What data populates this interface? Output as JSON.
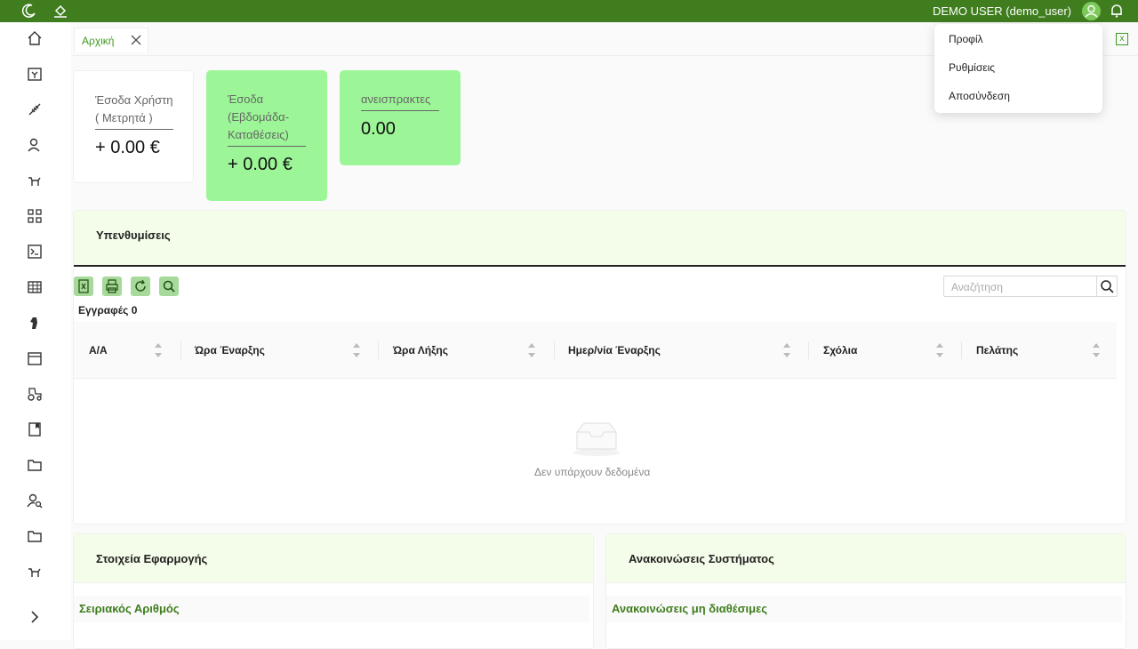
{
  "header": {
    "user_label": "DEMO USER (demo_user)",
    "icons": [
      "moon-icon",
      "paint-bucket-icon",
      "user-avatar-icon",
      "bell-icon"
    ]
  },
  "user_menu": {
    "items": [
      "Προφίλ",
      "Ρυθμίσεις",
      "Αποσύνδεση"
    ]
  },
  "sidebar": {
    "icons": [
      "home-icon",
      "calendar-yen-icon",
      "wheat-icon",
      "user-icon",
      "cow-icon",
      "qrcode-icon",
      "terminal-icon",
      "table-icon",
      "horse-head-icon",
      "calendar-icon",
      "tractor-icon",
      "book-icon",
      "folder-icon",
      "user-search-icon",
      "folder-icon",
      "cow-icon",
      "chevron-right-icon"
    ]
  },
  "tabs": {
    "active_label": "Αρχική"
  },
  "cards": [
    {
      "title": "Έσοδα Χρήστη ( Μετρητά )",
      "value": "+ 0.00 €"
    },
    {
      "title": "Έσοδα (Εβδομάδα-Καταθέσεις)",
      "value": "+ 0.00 €"
    },
    {
      "title": "ανεισπρακτες",
      "value": "0.00"
    }
  ],
  "reminders": {
    "title": "Υπενθυμίσεις",
    "records_label": "Εγγραφές 0",
    "search_placeholder": "Αναζήτηση",
    "columns": [
      "Α/Α",
      "Ώρα Έναρξης",
      "Ώρα Λήξης",
      "Ημερ/νία Έναρξης",
      "Σχόλια",
      "Πελάτης"
    ],
    "empty_text": "Δεν υπάρχουν δεδομένα"
  },
  "app_info": {
    "title": "Στοιχεία Εφαρμογής",
    "row_label": "Σειριακός Αριθμός"
  },
  "announcements": {
    "title": "Ανακοινώσεις Συστήματος",
    "row_label": "Ανακοινώσεις μη διαθέσιμες"
  },
  "colors": {
    "topbar": "#3f7d1e",
    "card_green": "#9cf697",
    "accent": "#3a9b1f"
  }
}
